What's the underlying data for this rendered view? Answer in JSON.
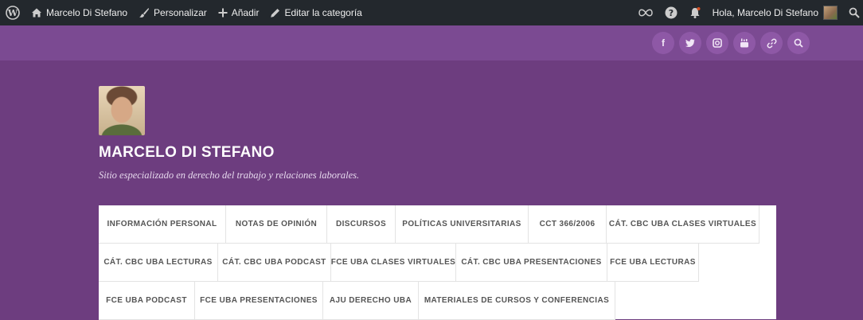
{
  "admin_bar": {
    "site_name": "Marcelo Di Stefano",
    "customize": "Personalizar",
    "add_new": "Añadir",
    "edit": "Editar la categoría",
    "greeting": "Hola, Marcelo Di Stefano",
    "icons": [
      "wordpress-icon",
      "home-icon",
      "brush-icon",
      "plus-icon",
      "pencil-icon",
      "infinity-icon",
      "help-icon",
      "bell-icon",
      "search-icon"
    ]
  },
  "social": [
    {
      "icon": "facebook-icon",
      "glyph": "f"
    },
    {
      "icon": "twitter-icon",
      "glyph": "🐦"
    },
    {
      "icon": "instagram-icon",
      "glyph": "◘"
    },
    {
      "icon": "youtube-icon",
      "glyph": "▶"
    },
    {
      "icon": "link-icon",
      "glyph": "%"
    },
    {
      "icon": "search-icon",
      "glyph": "⌕"
    }
  ],
  "header": {
    "title": "MARCELO DI STEFANO",
    "description": "Sitio especializado en derecho del trabajo y relaciones laborales."
  },
  "nav": {
    "rows": [
      [
        "INFORMACIÓN PERSONAL",
        "NOTAS DE OPINIÓN",
        "DISCURSOS",
        "POLÍTICAS UNIVERSITARIAS",
        "CCT 366/2006",
        "CÁT. CBC UBA CLASES VIRTUALES"
      ],
      [
        "CÁT. CBC UBA LECTURAS",
        "CÁT. CBC UBA PODCAST",
        "FCE UBA CLASES VIRTUALES",
        "CÁT. CBC UBA PRESENTACIONES",
        "FCE UBA LECTURAS"
      ],
      [
        "FCE UBA PODCAST",
        "FCE UBA PRESENTACIONES",
        "AJU DERECHO UBA",
        "MATERIALES DE CURSOS Y CONFERENCIAS"
      ]
    ]
  },
  "colors": {
    "admin_bar": "#23282d",
    "social_bar": "#7b4a92",
    "header_bg": "#6d3d7f",
    "nav_bg": "#ffffff"
  }
}
